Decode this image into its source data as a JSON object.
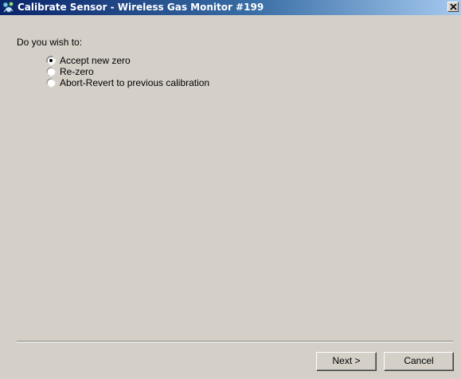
{
  "window": {
    "title": "Calibrate Sensor - Wireless Gas Monitor #199",
    "title_icon": "sensor-app-icon",
    "close_icon": "close-icon"
  },
  "prompt": "Do you wish to:",
  "options": [
    {
      "label": "Accept new zero",
      "selected": true
    },
    {
      "label": "Re-zero",
      "selected": false
    },
    {
      "label": "Abort-Revert to previous calibration",
      "selected": false
    }
  ],
  "buttons": {
    "next": "Next >",
    "cancel": "Cancel"
  },
  "colors": {
    "titlebar_start": "#0a246a",
    "titlebar_end": "#a6caf0",
    "face": "#d4d0c8"
  }
}
